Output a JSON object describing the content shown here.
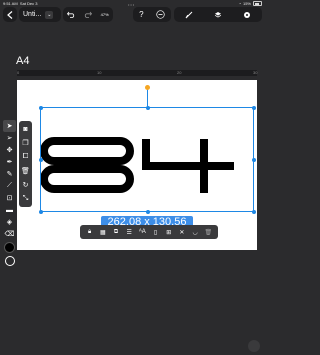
{
  "status": {
    "time": "9:51 AM",
    "date": "Sat Dec 3",
    "battery": "15%"
  },
  "toolbar": {
    "title": "Unti...",
    "zoom": "47%",
    "help": "?"
  },
  "canvas": {
    "label": "A4",
    "ruler_ticks": [
      "0",
      "10",
      "20",
      "30"
    ]
  },
  "selection": {
    "size_text": "262.08 x 130.56"
  },
  "artwork": {
    "text": "84",
    "color": "#000000"
  },
  "colors": {
    "accent": "#1e88e5",
    "rotate_handle": "#f5a623",
    "size_label": "#3d8ee8",
    "panel": "#1d1d1f"
  },
  "left_tools": [
    "select-icon",
    "direct-select-icon",
    "node-icon",
    "pen-icon",
    "pencil-icon",
    "brush-icon",
    "image-icon",
    "rectangle-icon",
    "fill-icon",
    "eraser-icon"
  ],
  "sub_tools": [
    "camera-icon",
    "copy-icon",
    "duplicate-icon",
    "trash-icon",
    "refresh-icon",
    "transform-icon"
  ],
  "ctx_tools": [
    "lock-icon",
    "checker-icon",
    "group-icon",
    "align-icon",
    "text-icon",
    "page-icon",
    "arrange-icon",
    "flip-icon",
    "mask-icon",
    "trash-icon"
  ]
}
